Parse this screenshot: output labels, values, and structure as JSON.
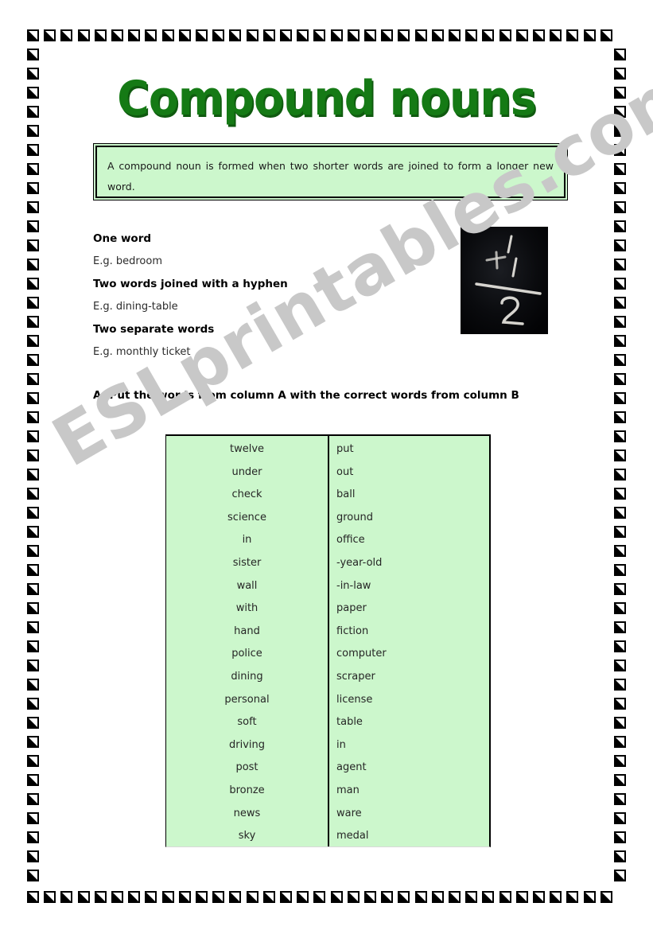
{
  "title": "Compound nouns",
  "definition": "A compound noun is formed when two shorter words are joined to form a longer new word.",
  "watermark": "ESLprintables.com",
  "rules": [
    {
      "heading": "One word",
      "example": "E.g. bedroom"
    },
    {
      "heading": "Two words joined with a hyphen",
      "example": "E.g. dining-table"
    },
    {
      "heading": "Two separate words",
      "example": "E.g. monthly ticket"
    }
  ],
  "instruction": "A. Put the words from column A with the correct words from column B",
  "photo": {
    "alt": "chalkboard-math-equation",
    "background": "#050608"
  },
  "table": {
    "background": "#ccf7cc",
    "column_a": [
      "twelve",
      "under",
      "check",
      "science",
      "in",
      "sister",
      "wall",
      "with",
      "hand",
      "police",
      "dining",
      "personal",
      "soft",
      "driving",
      "post",
      "bronze",
      "news",
      "sky"
    ],
    "column_b": [
      "put",
      "out",
      "ball",
      "ground",
      "office",
      "-year-old",
      "-in-law",
      "paper",
      "fiction",
      "computer",
      "scraper",
      "license",
      "table",
      "in",
      "agent",
      "man",
      "ware",
      "medal"
    ]
  },
  "colors": {
    "title_green": "#157a15",
    "panel_green": "#ccf7cc",
    "watermark_gray": "#c8c8c8",
    "border_black": "#000000"
  },
  "border": {
    "tile_icon": "square-with-triangle-icon",
    "top_count": 32,
    "bottom_count": 32,
    "side_count": 44
  }
}
